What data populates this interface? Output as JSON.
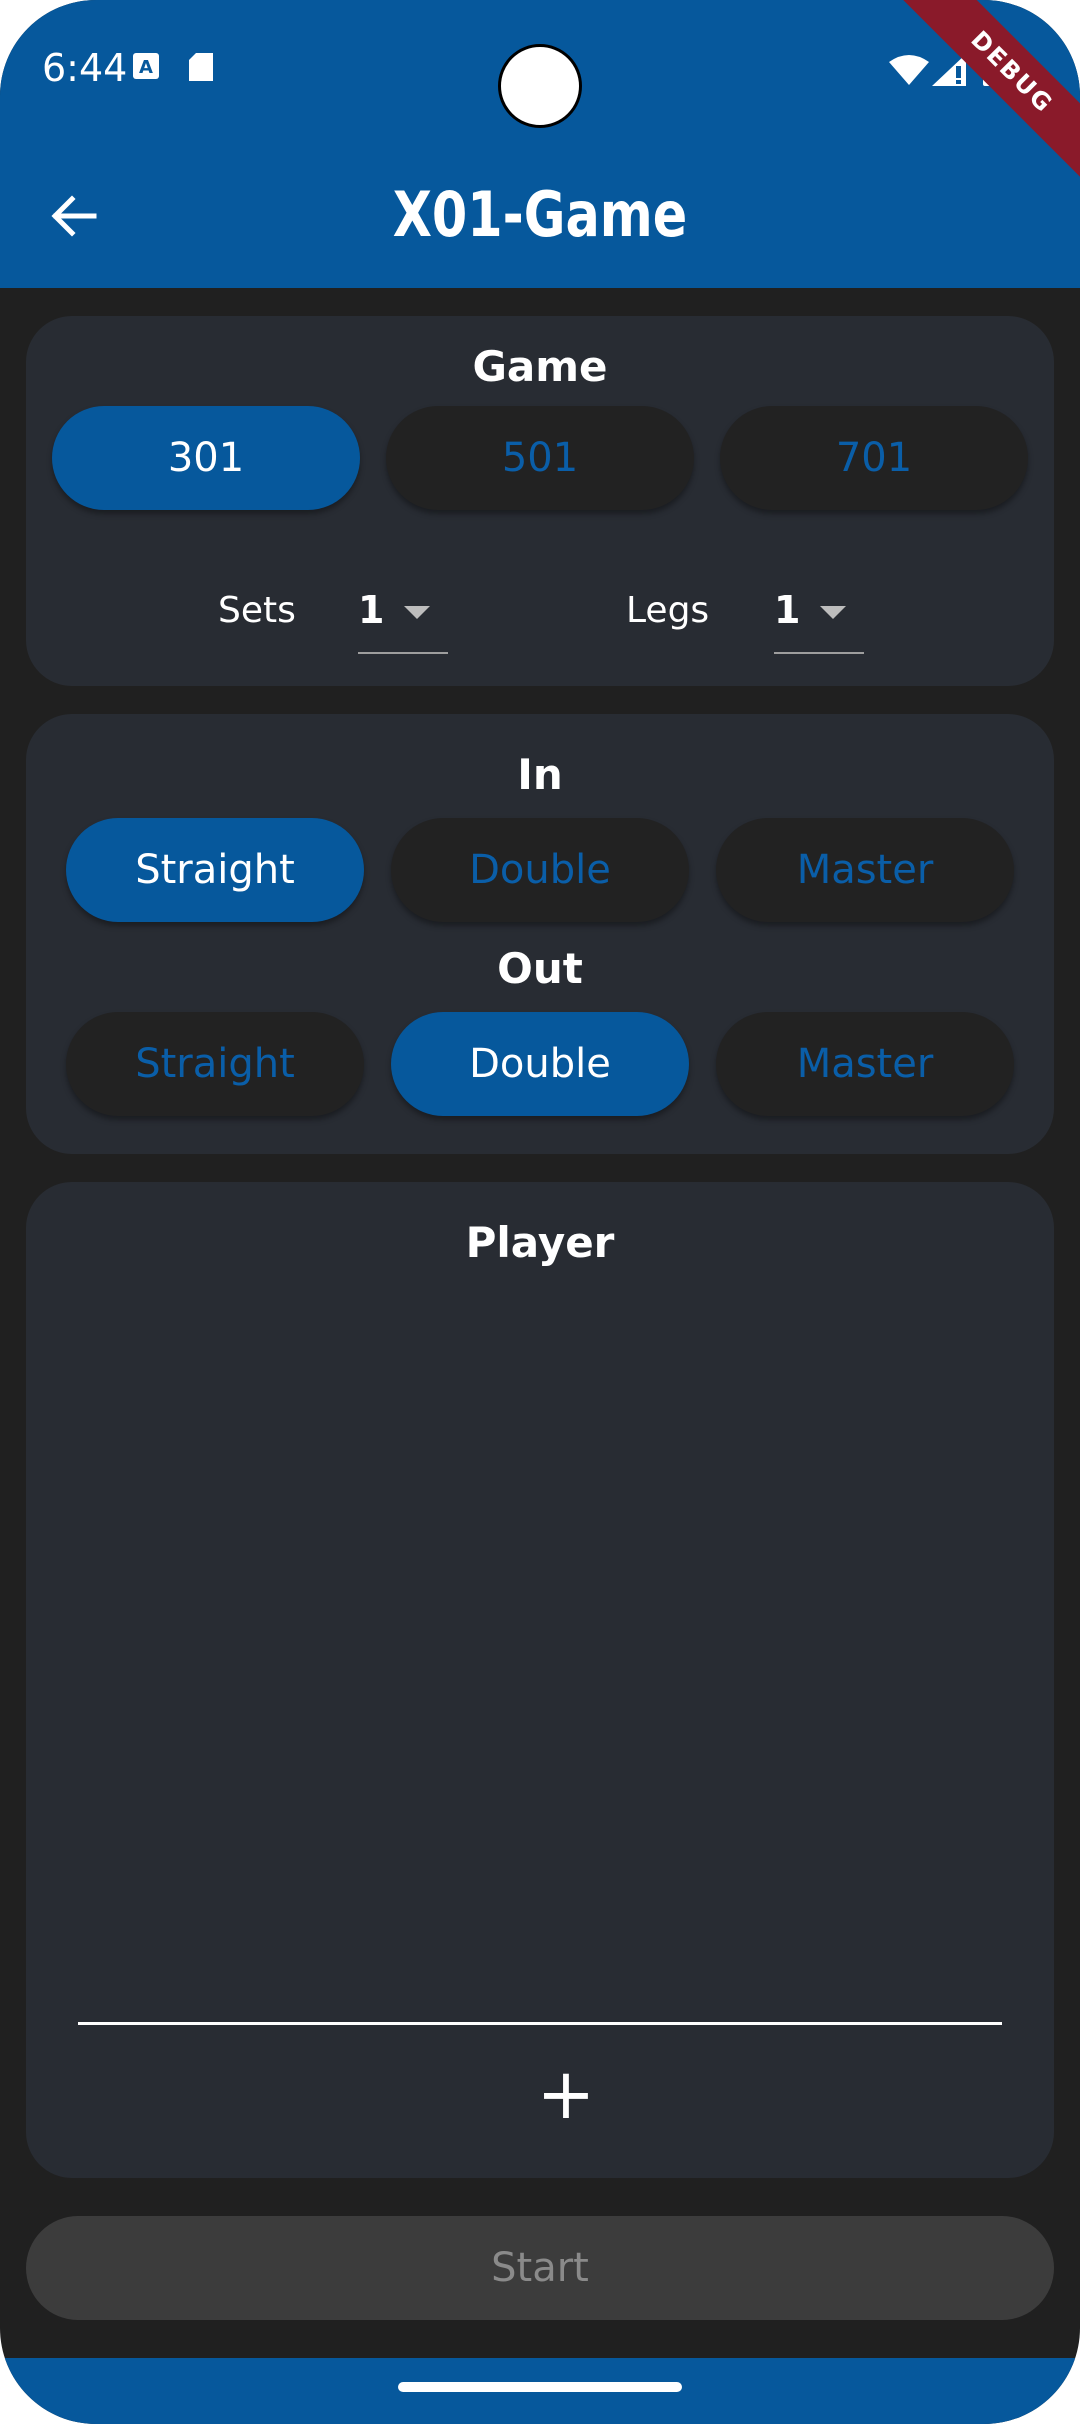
{
  "status_bar": {
    "time": "6:44",
    "icons": [
      "a-notification-icon",
      "sd-card-icon",
      "wifi-icon",
      "cell-signal-icon",
      "battery-icon"
    ],
    "debug_label": "DEBUG"
  },
  "app_bar": {
    "title": "X01-Game",
    "back_icon": "arrow-back-icon",
    "color": "#06589c"
  },
  "game_card": {
    "title": "Game",
    "options": [
      "301",
      "501",
      "701"
    ],
    "selected": "301",
    "sets_label": "Sets",
    "sets_value": "1",
    "legs_label": "Legs",
    "legs_value": "1"
  },
  "in_out_card": {
    "in_title": "In",
    "in_options": [
      "Straight",
      "Double",
      "Master"
    ],
    "in_selected": "Straight",
    "out_title": "Out",
    "out_options": [
      "Straight",
      "Double",
      "Master"
    ],
    "out_selected": "Double"
  },
  "player_card": {
    "title": "Player",
    "add_label": "+"
  },
  "start_button": {
    "label": "Start"
  },
  "colors": {
    "accent": "#06589c",
    "background": "#202020",
    "card": "#282c33",
    "inactive_pill": "#222222",
    "inactive_text": "#0a5ea8"
  }
}
